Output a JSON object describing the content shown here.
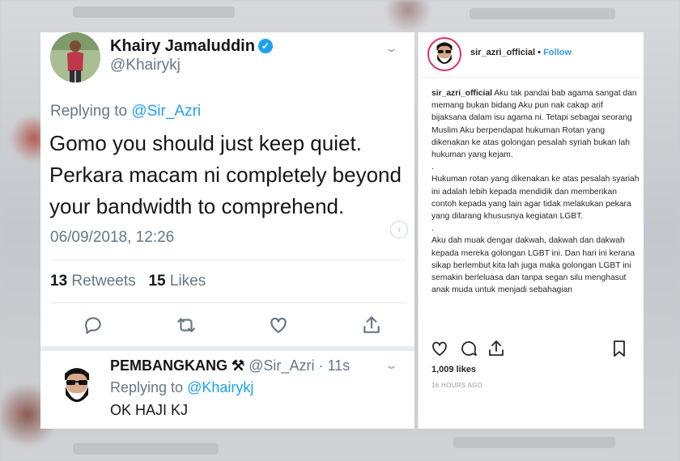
{
  "twitter": {
    "author_name": "Khairy Jamaluddin",
    "author_handle": "@Khairykj",
    "replying_prefix": "Replying to ",
    "replying_to": "@Sir_Azri",
    "text_line1": "Gomo you should just keep quiet.",
    "text_line2": "Perkara macam ni completely beyond",
    "text_line3": "your bandwidth to comprehend.",
    "date": "06/09/2018, 12:26",
    "retweets_count": "13",
    "retweets_label": "Retweets",
    "likes_count": "15",
    "likes_label": "Likes",
    "actions": [
      "reply-icon",
      "retweet-icon",
      "like-icon",
      "share-icon"
    ],
    "reply": {
      "author_name": "PEMBANGKANG ⚒",
      "author_handle": "@Sir_Azri",
      "time": "· 11s",
      "replying_prefix": "Replying to ",
      "replying_to": "@Khairykj",
      "text": "OK HAJI KJ"
    },
    "colors": {
      "link": "#1da1f2",
      "muted": "#657786",
      "text": "#14171a"
    }
  },
  "instagram": {
    "username": "sir_azri_official",
    "dot": "•",
    "follow_label": "Follow",
    "caption_user": "sir_azri_official",
    "caption_p1": " Aku tak pandai bab agama sangat dan memang bukan bidang Aku pun nak cakap arif bijaksana dalam isu agama ni. Tetapi sebagai seorang Muslim Aku berpendapat hukuman Rotan yang dikenakan ke atas golongan pesalah syriah bukan lah hukuman yang kejam.",
    "caption_sep1": ".",
    "caption_p2": "Hukuman rotan yang dikenakan ke atas pesalah syariah ini adalah lebih kepada mendidik dan memberikan contoh kepada yang lain agar tidak melakukan pekara yang dilarang khususnya kegiatan LGBT.",
    "caption_sep2": ".",
    "caption_p3": "Aku dah muak dengar dakwah, dakwah dan dakwah kepada mereka golongan LGBT ini. Dan hari ini kerana sikap berlembut kita lah juga maka golongan LGBT ini semakin berleluasa dan tanpa segan silu menghasut anak muda untuk menjadi sebahagian",
    "likes": "1,009 likes",
    "time": "16 HOURS AGO",
    "actions": [
      "heart-icon",
      "comment-icon",
      "share-icon",
      "bookmark-icon"
    ],
    "colors": {
      "follow": "#3897f0",
      "ring": "#e1306c"
    }
  }
}
